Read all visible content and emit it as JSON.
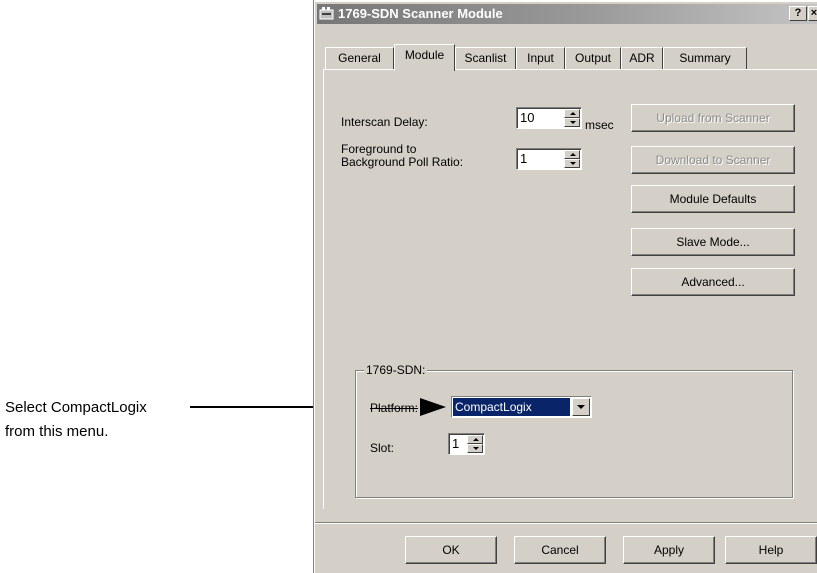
{
  "callout": {
    "line1": "Select CompactLogix",
    "line2": "from this menu."
  },
  "window": {
    "title": "1769-SDN Scanner Module",
    "help_button": "?",
    "close_button": "×"
  },
  "tabs": [
    "General",
    "Module",
    "Scanlist",
    "Input",
    "Output",
    "ADR",
    "Summary"
  ],
  "active_tab": "Module",
  "module": {
    "interscan_label": "Interscan Delay:",
    "interscan_value": "10",
    "interscan_unit": "msec",
    "poll_ratio_label_line1": "Foreground to",
    "poll_ratio_label_line2": "Background Poll Ratio:",
    "poll_ratio_value": "1"
  },
  "side_buttons": {
    "upload": "Upload from Scanner",
    "download": "Download to Scanner",
    "defaults": "Module Defaults",
    "slave": "Slave Mode...",
    "advanced": "Advanced..."
  },
  "group": {
    "title": "1769-SDN:",
    "platform_label": "Platform:",
    "platform_value": "CompactLogix",
    "slot_label": "Slot:",
    "slot_value": "1"
  },
  "footer": {
    "ok": "OK",
    "cancel": "Cancel",
    "apply": "Apply",
    "help": "Help"
  },
  "colors": {
    "dialog_face": "#d4d0c8",
    "selection": "#0a246a"
  }
}
